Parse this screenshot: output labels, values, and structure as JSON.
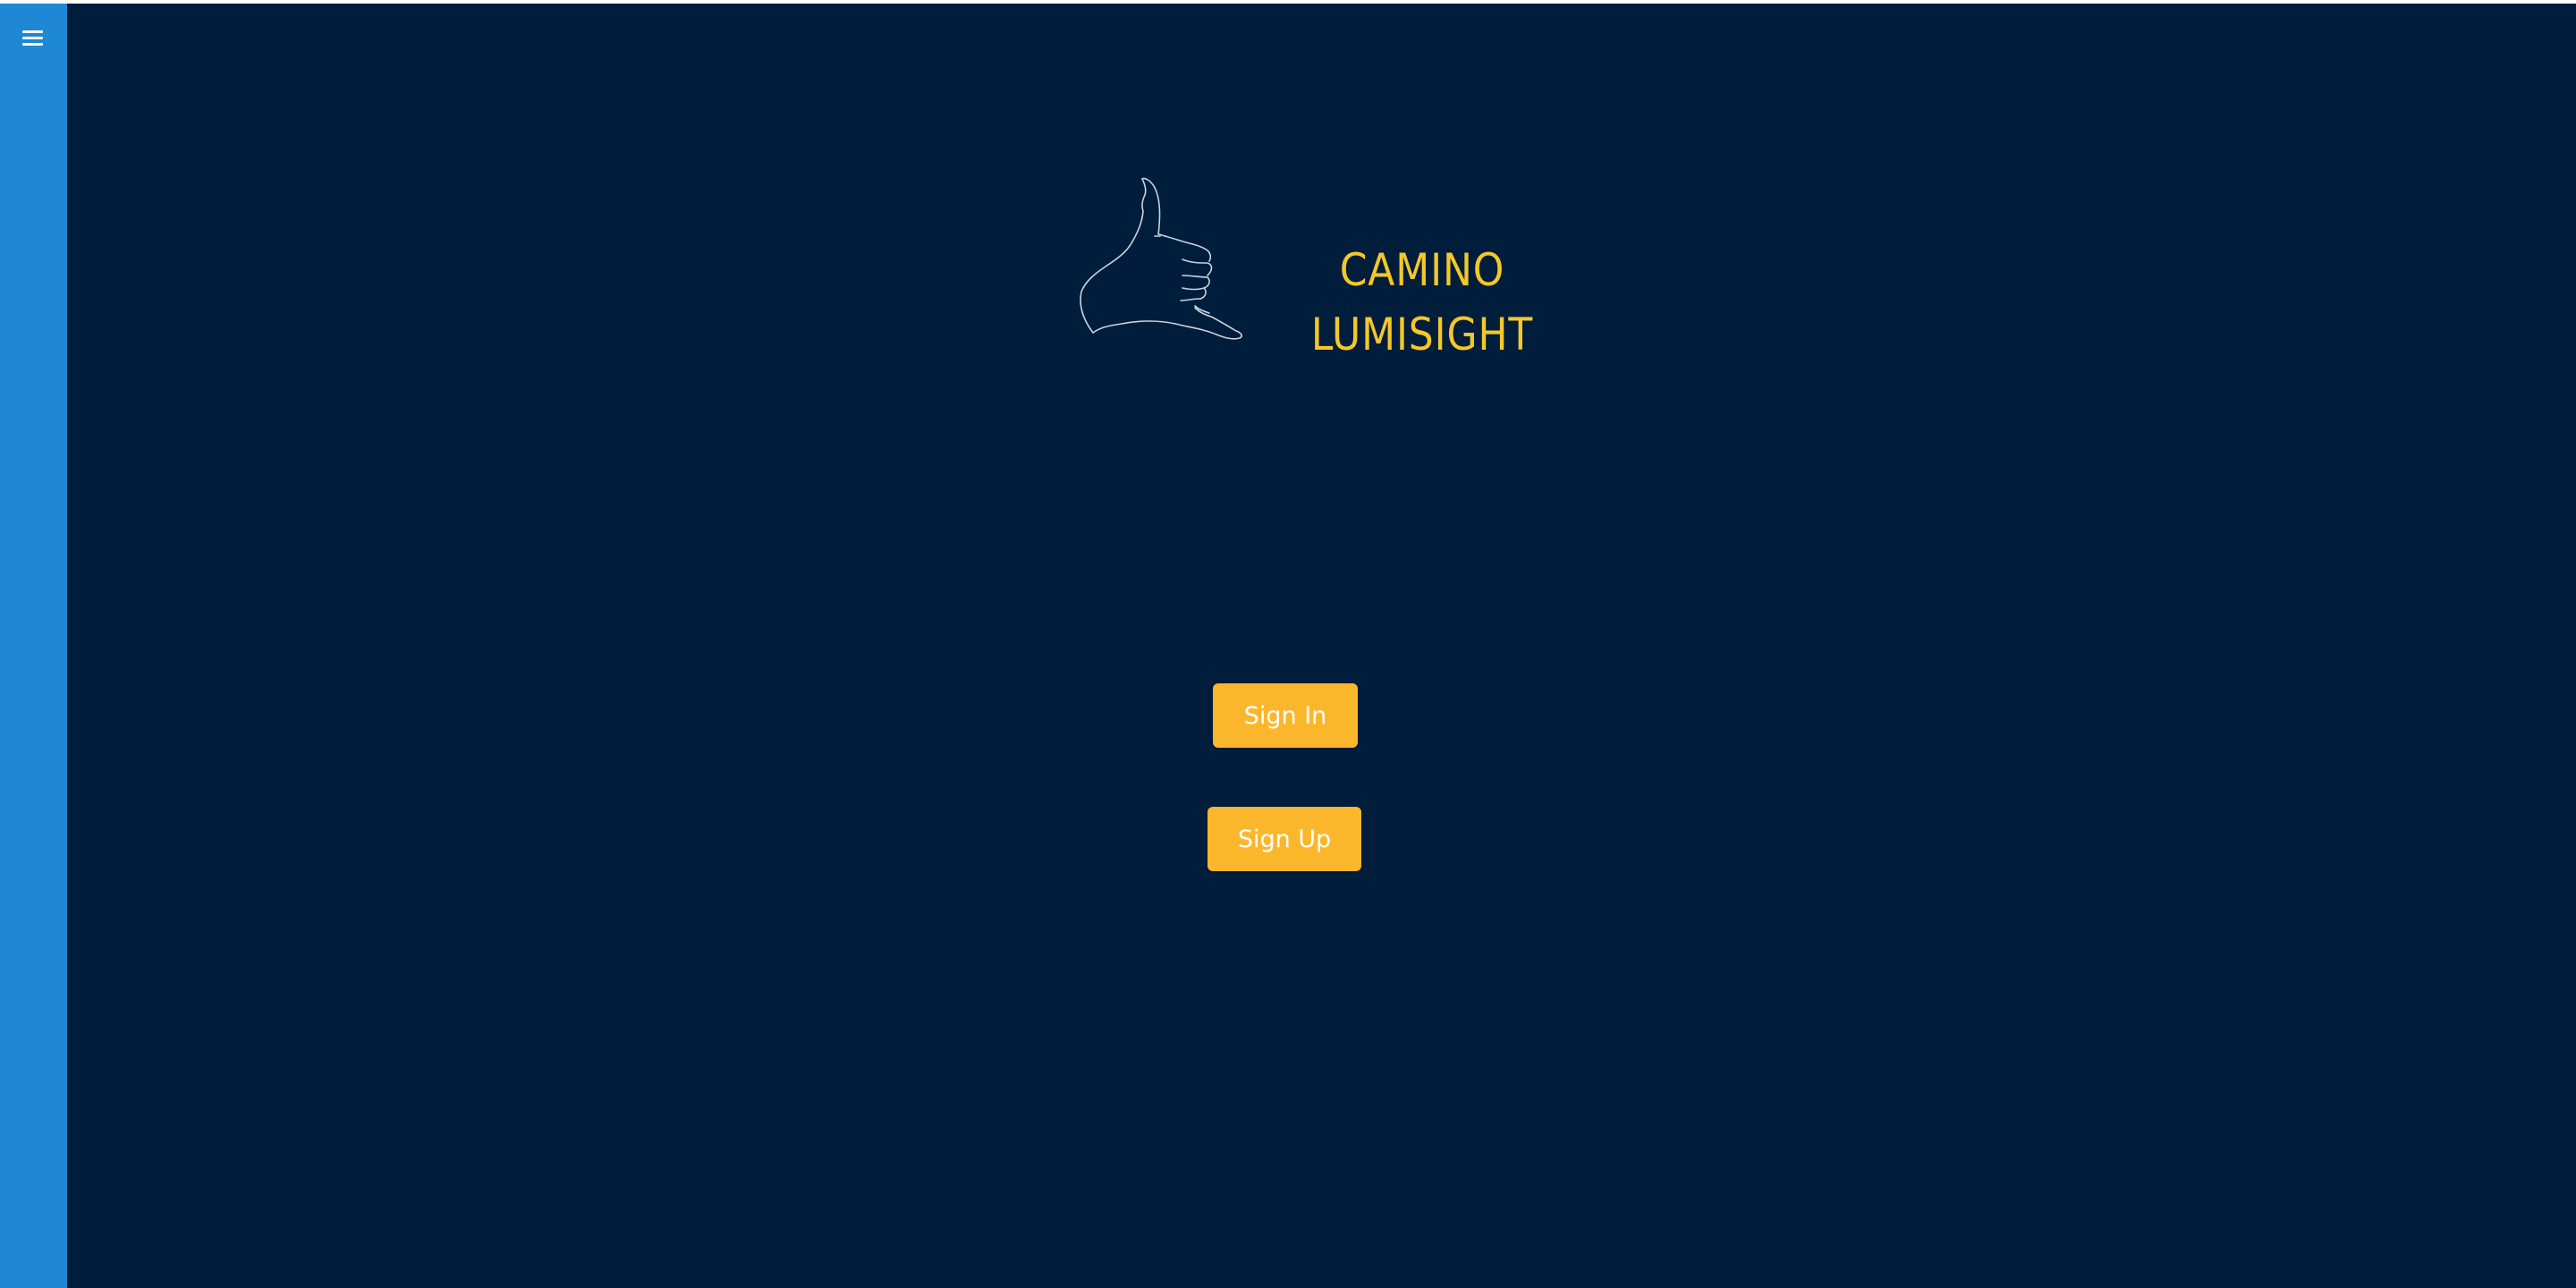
{
  "sidebar": {
    "menu_icon": "hamburger-menu-icon"
  },
  "brand": {
    "logo_icon": "shaka-hand-icon",
    "line1": "CAMINO",
    "line2": "LUMISIGHT"
  },
  "auth": {
    "sign_in_label": "Sign In",
    "sign_up_label": "Sign Up"
  },
  "colors": {
    "background": "#001d3b",
    "sidebar": "#1e88d4",
    "brand_text": "#f4c82b",
    "button": "#fbb72c",
    "button_text": "#ffffff",
    "logo_stroke": "#c9d3de"
  }
}
